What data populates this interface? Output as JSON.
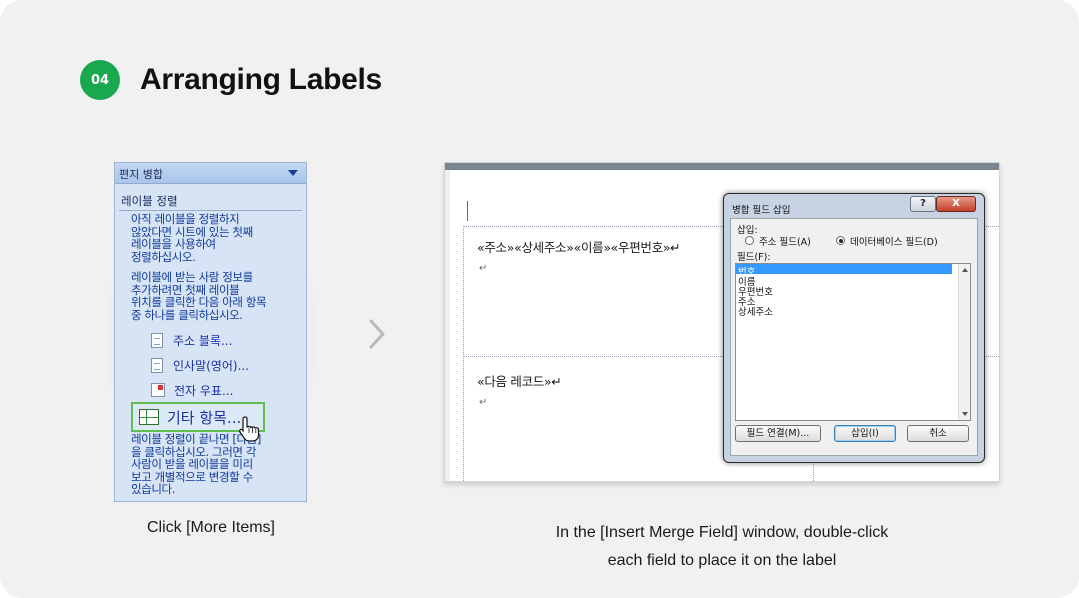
{
  "header": {
    "step_number": "04",
    "title": "Arranging Labels"
  },
  "task_pane": {
    "title": "편지 병합",
    "section": "레이블 정렬",
    "intro_lines": [
      "아직 레이블을 정렬하지",
      "않았다면 시트에 있는 첫째",
      "레이블을 사용하여",
      "정렬하십시오."
    ],
    "instruction_lines": [
      "레이블에 받는 사람 정보를",
      "추가하려면 첫째 레이블",
      "위치를 클릭한 다음 아래 항목",
      "중 하나를 클릭하십시오."
    ],
    "links": [
      {
        "label": "주소 블록...",
        "icon": "document-icon"
      },
      {
        "label": "인사말(영어)...",
        "icon": "document-icon"
      },
      {
        "label": "전자 우표...",
        "icon": "stamp-icon"
      }
    ],
    "more_items_label": "기타 항목...",
    "footer_lines": [
      "레이블 정렬이 끝나면 [다음]",
      "을 클릭하십시오. 그러면 각",
      "사람이 받을 레이블을 미리",
      "보고 개별적으로 변경할 수",
      "있습니다."
    ]
  },
  "caption_left": "Click [More Items]",
  "document": {
    "merge_line": "«주소»«상세주소»«이름»«우편번호»↵",
    "next_record": "«다음 레코드»↵",
    "para_mark": "↵"
  },
  "dialog": {
    "title": "병합 필드 삽입",
    "help_label": "?",
    "close_label": "X",
    "insert_label": "삽입:",
    "radio_address": "주소 필드(A)",
    "radio_database": "데이터베이스 필드(D)",
    "fields_label": "필드(F):",
    "fields": [
      "번호",
      "이름",
      "우편번호",
      "주소",
      "상세주소"
    ],
    "selected_field": "번호",
    "btn_match": "필드 연결(M)...",
    "btn_insert": "삽입(I)",
    "btn_cancel": "취소"
  },
  "caption_right": {
    "line1": "In the [Insert Merge Field] window, double-click",
    "line2": "each field to place it on the label"
  },
  "colors": {
    "badge": "#1aa84f",
    "highlight": "#5fbf4a",
    "link": "#1b2fa8",
    "selection": "#3399ff"
  }
}
